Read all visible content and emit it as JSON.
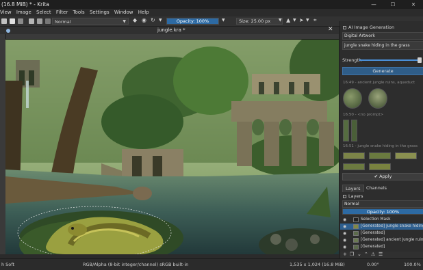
{
  "window": {
    "title": "(16.8 MiB)  * - Krita",
    "minimize": "—",
    "maximize": "☐",
    "close": "✕"
  },
  "menu": [
    "View",
    "Image",
    "Select",
    "Filter",
    "Tools",
    "Settings",
    "Window",
    "Help"
  ],
  "toolbar": {
    "blend_mode": "Normal",
    "opacity_label": "Opacity: 100%",
    "size_label": "Size: 25.00 px"
  },
  "document": {
    "tab_title": "jungle.kra *",
    "close_glyph": "✕"
  },
  "ai_panel": {
    "header": "AI Image Generation",
    "workspace": "Digital Artwork",
    "prompt": "jungle snake hiding in the grass",
    "strength_label": "Strength",
    "strength_value": 1.0,
    "generate_label": "Generate",
    "history": [
      {
        "label": "16:49 - ancient jungle ruins, aqueduct"
      },
      {
        "label": "16:50 - <no prompt>"
      },
      {
        "label": "16:51 - jungle snake hiding in the grass"
      }
    ],
    "apply_label": "Apply"
  },
  "layers_panel": {
    "tabs": [
      "Layers",
      "Channels"
    ],
    "header": "Layers",
    "blend_mode": "Normal",
    "opacity_label": "Opacity: 100%",
    "rows": [
      {
        "name": "Selection Mask",
        "selected": false
      },
      {
        "name": "[Generated] jungle snake hiding in the grass",
        "selected": true
      },
      {
        "name": "[Generated]",
        "selected": false
      },
      {
        "name": "[Generated] ancient jungle ruins, aqueduct",
        "selected": false
      },
      {
        "name": "[Generated]",
        "selected": false
      }
    ]
  },
  "status": {
    "brush": "h Soft",
    "color_profile": "RGB/Alpha (8-bit integer/channel)  sRGB built-in",
    "dimensions": "1,535 x 1,024 (16.8 MiB)",
    "rotation": "0.00°",
    "zoom": "100.0%"
  }
}
